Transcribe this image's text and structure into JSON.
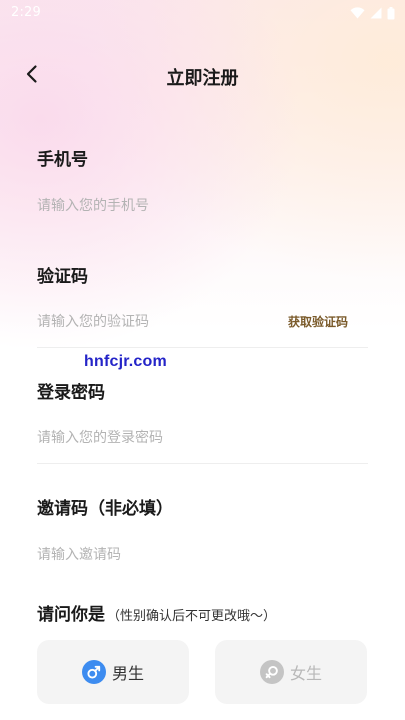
{
  "status_bar": {
    "time": "2:29"
  },
  "header": {
    "title": "立即注册",
    "back_icon": "chevron-left-icon"
  },
  "form": {
    "phone": {
      "label": "手机号",
      "placeholder": "请输入您的手机号"
    },
    "code": {
      "label": "验证码",
      "placeholder": "请输入您的验证码",
      "get_code_label": "获取验证码"
    },
    "password": {
      "label": "登录密码",
      "placeholder": "请输入您的登录密码"
    },
    "invite": {
      "label": "邀请码（非必填）",
      "placeholder": "请输入邀请码"
    }
  },
  "gender": {
    "question": "请问你是",
    "hint": "（性别确认后不可更改哦～）",
    "male_label": "男生",
    "female_label": "女生",
    "selected": "male"
  },
  "watermark": "hnfcjr.com",
  "colors": {
    "male_accent": "#3d8cf0",
    "female_inactive": "#c4c4c4",
    "get_code": "#7a5a2a"
  }
}
